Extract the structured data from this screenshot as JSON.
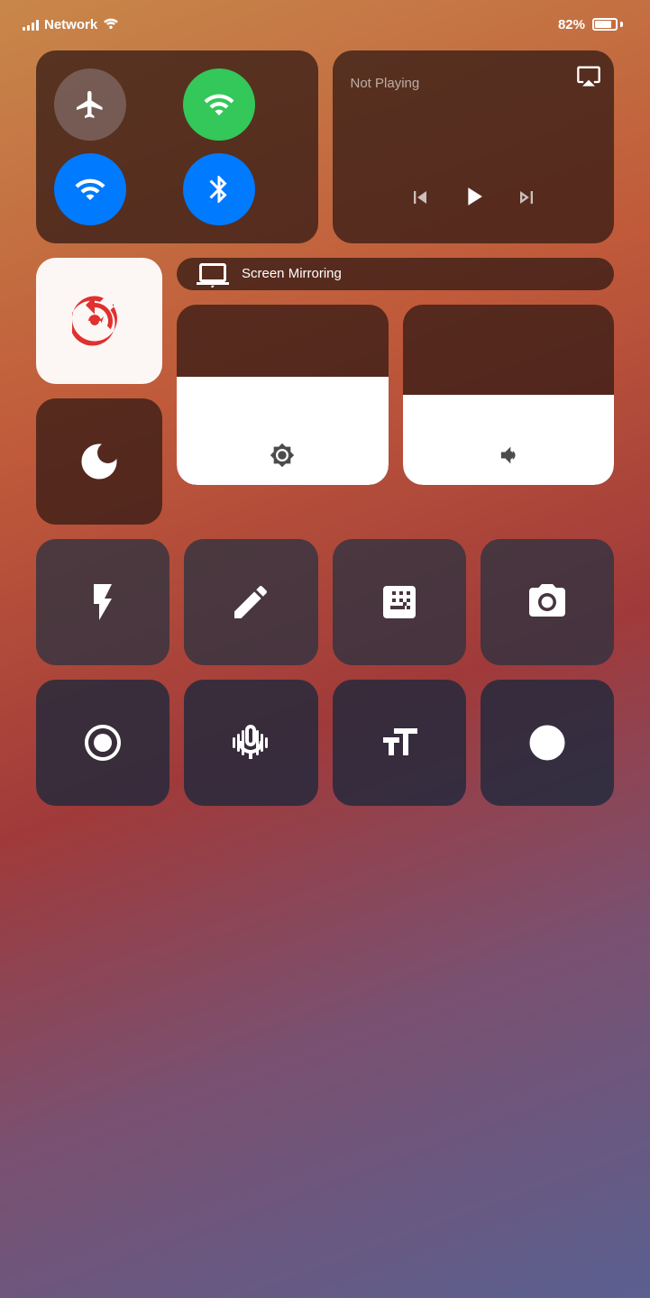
{
  "status_bar": {
    "network_label": "Network",
    "battery_percent": "82%",
    "signal_bars": [
      4,
      6,
      8,
      10,
      12
    ],
    "wifi_active": true
  },
  "network_tile": {
    "airplane_label": "Airplane Mode",
    "cellular_label": "Cellular",
    "wifi_label": "Wi-Fi",
    "bluetooth_label": "Bluetooth"
  },
  "now_playing": {
    "label": "Not Playing",
    "play_label": "▶",
    "rewind_label": "⏪",
    "fast_forward_label": "⏩"
  },
  "lock_rotation": {
    "label": "Portrait Orientation Lock"
  },
  "do_not_disturb": {
    "label": "Do Not Disturb"
  },
  "brightness": {
    "label": "Brightness",
    "value": 60
  },
  "volume": {
    "label": "Volume",
    "value": 50
  },
  "screen_mirroring": {
    "label": "Screen\nMirroring"
  },
  "bottom_row1": {
    "flashlight": "Flashlight",
    "notes": "Notes",
    "calculator": "Calculator",
    "camera": "Camera"
  },
  "bottom_row2": {
    "screen_record": "Screen Record",
    "voice_memos": "Voice Memos",
    "text_size": "Text Size",
    "clock": "Clock"
  }
}
